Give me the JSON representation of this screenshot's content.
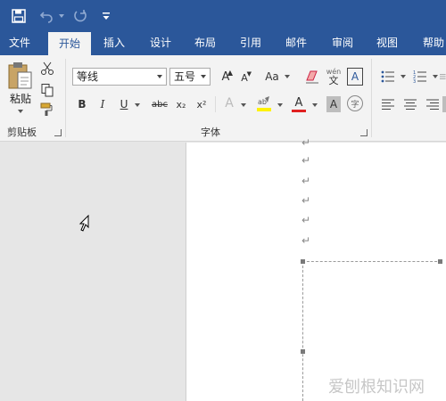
{
  "tabs": [
    "文件",
    "开始",
    "插入",
    "设计",
    "布局",
    "引用",
    "邮件",
    "审阅",
    "视图",
    "帮助"
  ],
  "clipboard": {
    "paste_label": "粘贴",
    "group_label": "剪贴板"
  },
  "font": {
    "name": "等线",
    "size": "五号",
    "group_label": "字体",
    "bold": "B",
    "italic": "I",
    "underline": "U",
    "strike": "abc",
    "subscript": "x₂",
    "superscript": "x²",
    "case": "Aa",
    "grow": "A",
    "shrink": "A",
    "phonetic_top": "wén",
    "phonetic_bottom": "文",
    "border_char": "A",
    "effects": "A",
    "font_color": "A",
    "shading": "A",
    "enclose": "字"
  },
  "doc": {
    "para_mark": "↵"
  },
  "watermark": "爱刨根知识网",
  "colors": {
    "accent": "#2b579a",
    "font_color_bar": "#e02020",
    "highlight_bar": "#fff200"
  }
}
